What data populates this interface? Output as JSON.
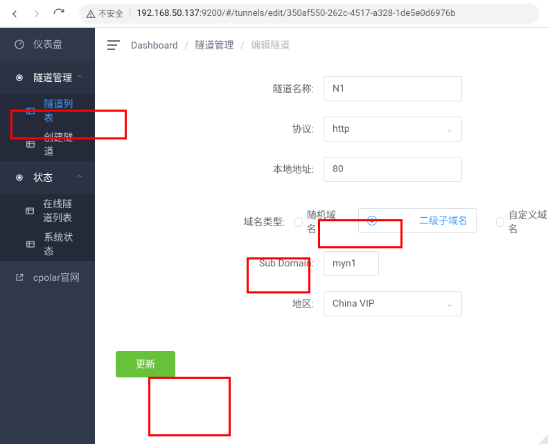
{
  "browser": {
    "insecure_label": "不安全",
    "url_host": "192.168.50.137",
    "url_port": ":9200",
    "url_path": "/#/tunnels/edit/350af550-262c-4517-a328-1de5e0d6976b"
  },
  "sidebar": {
    "items": [
      {
        "label": "仪表盘"
      },
      {
        "label": "隧道管理"
      },
      {
        "label": "隧道列表"
      },
      {
        "label": "创建隧道"
      },
      {
        "label": "状态"
      },
      {
        "label": "在线隧道列表"
      },
      {
        "label": "系统状态"
      },
      {
        "label": "cpolar官网"
      }
    ]
  },
  "breadcrumb": {
    "a": "Dashboard",
    "b": "隧道管理",
    "c": "编辑隧道"
  },
  "form": {
    "tunnel_name_label": "隧道名称:",
    "tunnel_name_value": "N1",
    "protocol_label": "协议:",
    "protocol_value": "http",
    "local_addr_label": "本地地址:",
    "local_addr_value": "80",
    "domain_type_label": "域名类型:",
    "domain_opts": {
      "random": "随机域名",
      "subdomain": "二级子域名",
      "custom": "自定义域名"
    },
    "domain_selected": "二级子域名",
    "subdomain_label": "Sub Domain:",
    "subdomain_value": "myn1",
    "region_label": "地区:",
    "region_value": "China VIP",
    "update_btn": "更新"
  }
}
